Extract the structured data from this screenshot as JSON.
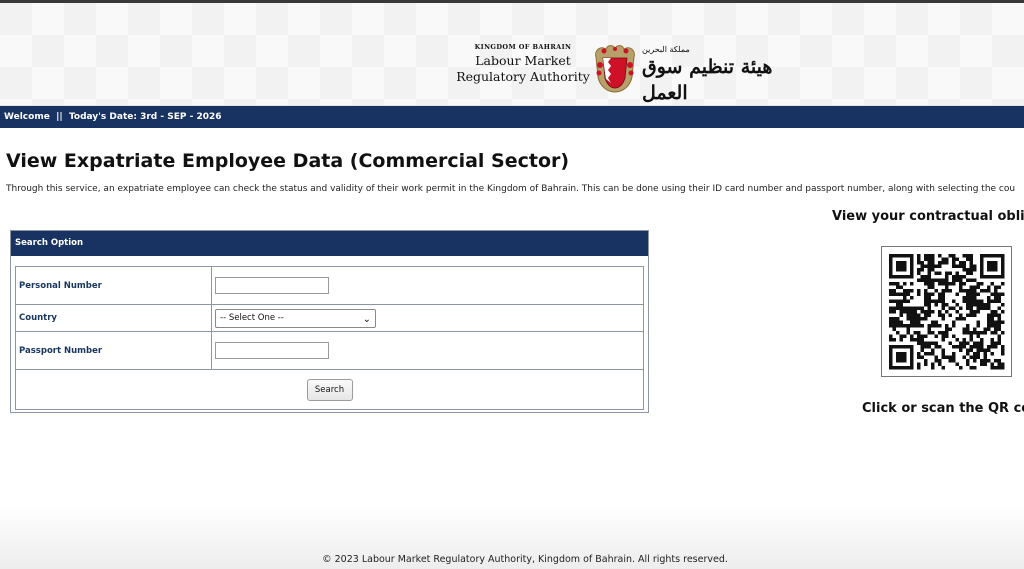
{
  "header": {
    "kingdom_label": "KINGDOM OF BAHRAIN",
    "org_line1": "Labour Market",
    "org_line2": "Regulatory Authority",
    "arabic_small": "مملكة البحرين",
    "arabic_name": "هيئة تنظيم سوق العمل",
    "emblem_icon": "bahrain-emblem-icon",
    "emblem_colors": {
      "red": "#ce1126",
      "white": "#ffffff"
    }
  },
  "navbar": {
    "welcome": "Welcome",
    "separator": "||",
    "date_text": "Today's Date: 3rd - SEP - 2026",
    "bg_color": "#183261"
  },
  "main": {
    "title": "View Expatriate Employee Data (Commercial Sector)",
    "description": "Through this service, an expatriate employee can check the status and validity of their work permit in the Kingdom of Bahrain. This can be done using their ID card number and passport number, along with selecting the cou"
  },
  "search_panel": {
    "header": "Search Option",
    "fields": {
      "personal_number": {
        "label": "Personal Number",
        "value": ""
      },
      "country": {
        "label": "Country",
        "selected": "-- Select One --"
      },
      "passport_number": {
        "label": "Passport Number",
        "value": ""
      }
    },
    "search_label": "Search"
  },
  "qr_section": {
    "heading": "View your contractual obliga",
    "caption": "Click or scan the QR cod",
    "qr_icon": "qr-code-icon"
  },
  "footer": {
    "copyright": "© 2023 Labour Market Regulatory Authority, Kingdom of Bahrain. All rights reserved."
  }
}
